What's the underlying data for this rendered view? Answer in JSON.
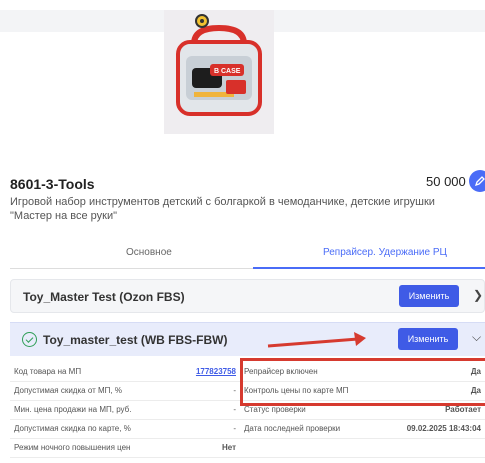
{
  "product": {
    "sku": "8601-3-Tools",
    "price": "50 000",
    "description": "Игровой набор инструментов детский с болгаркой в чемоданчике, детские игрушки \"Мастер на все руки\"",
    "image_caption": "B CASE"
  },
  "tabs": [
    {
      "label": "Основное"
    },
    {
      "label": "Репрайсер. Удержание РЦ"
    }
  ],
  "cards": [
    {
      "title": "Toy_Master Test (Ozon FBS)",
      "button": "Изменить"
    },
    {
      "title": "Toy_master_test (WB FBS-FBW)",
      "button": "Изменить"
    }
  ],
  "table": {
    "rows": [
      {
        "label1": "Код товара на МП",
        "value1": "177823758",
        "label2": "Репрайсер включен",
        "value2": "Да"
      },
      {
        "label1": "Допустимая скидка от МП, %",
        "value1": "-",
        "label2": "Контроль цены по карте МП",
        "value2": "Да"
      },
      {
        "label1": "Мин. цена продажи на МП, руб.",
        "value1": "-",
        "label2": "Статус проверки",
        "value2": "Работает"
      },
      {
        "label1": "Допустимая скидка по карте, %",
        "value1": "-",
        "label2": "Дата последней проверки",
        "value2": "09.02.2025 18:43:04"
      },
      {
        "label1": "Режим ночного повышения цен",
        "value1": "Нет",
        "label2": "",
        "value2": ""
      }
    ]
  },
  "colors": {
    "accent": "#3f5be6",
    "highlight": "#d63a2f",
    "active_card": "#e8ecfb"
  }
}
